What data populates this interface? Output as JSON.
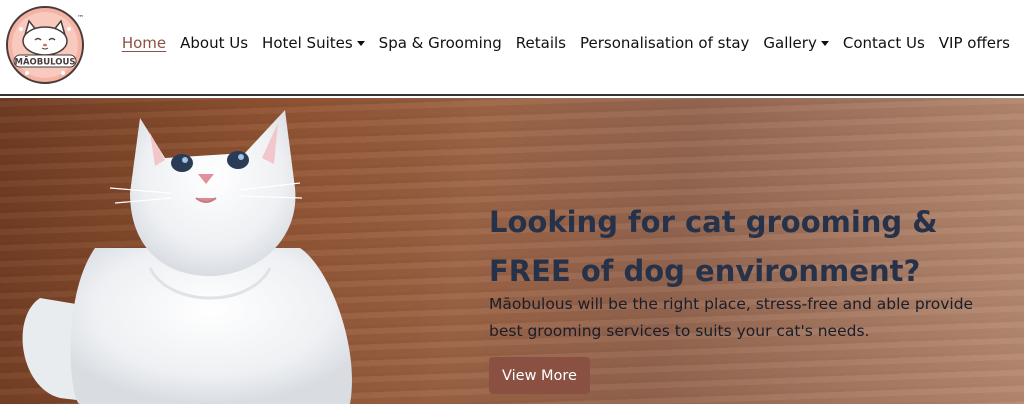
{
  "brand": {
    "logo_text": "MĀOBULOUS",
    "trademark": "™"
  },
  "nav": {
    "items": [
      {
        "label": "Home",
        "active": true
      },
      {
        "label": "About Us"
      },
      {
        "label": "Hotel Suites",
        "dropdown": true
      },
      {
        "label": "Spa & Grooming"
      },
      {
        "label": "Retails"
      },
      {
        "label": "Personalisation of stay"
      },
      {
        "label": "Gallery",
        "dropdown": true
      },
      {
        "label": "Contact Us"
      },
      {
        "label": "VIP offers"
      }
    ]
  },
  "hero": {
    "title": "Looking for cat grooming & FREE of dog environment?",
    "text": "Māobulous will be the right place, stress-free and able provide best grooming services to suits your cat's needs.",
    "button_label": "View More"
  },
  "colors": {
    "accent": "#8a5142",
    "active_link": "#8a5240",
    "title": "#26324a"
  },
  "icons": {
    "dropdown": "caret-down-icon",
    "logo": "cat-logo-icon"
  }
}
